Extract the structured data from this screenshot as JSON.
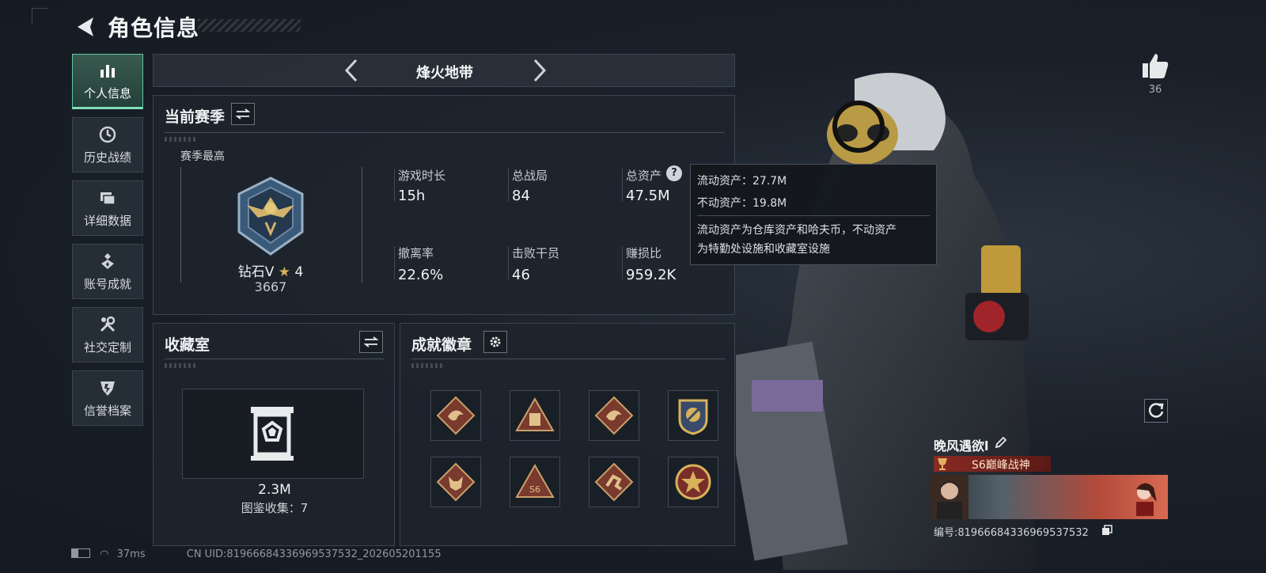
{
  "header": {
    "title": "角色信息"
  },
  "sidebar": {
    "items": [
      {
        "label": "个人信息",
        "icon": "bar-chart-icon",
        "active": true
      },
      {
        "label": "历史战绩",
        "icon": "clock-icon",
        "active": false
      },
      {
        "label": "详细数据",
        "icon": "folders-icon",
        "active": false
      },
      {
        "label": "账号成就",
        "icon": "medal-icon",
        "active": false
      },
      {
        "label": "社交定制",
        "icon": "wrench-icon",
        "active": false
      },
      {
        "label": "信誉档案",
        "icon": "shield-icon",
        "active": false
      }
    ]
  },
  "mode_bar": {
    "title": "烽火地带"
  },
  "season": {
    "title": "当前赛季",
    "best_label": "赛季最高",
    "rank_name": "钻石V",
    "rank_stars": "4",
    "rank_score": "3667",
    "stats": [
      {
        "label": "游戏时长",
        "value": "15h"
      },
      {
        "label": "总战局",
        "value": "84"
      },
      {
        "label": "总资产",
        "value": "47.5M"
      },
      {
        "label": "撤离率",
        "value": "22.6%"
      },
      {
        "label": "击败干员",
        "value": "46"
      },
      {
        "label": "赚损比",
        "value": "959.2K"
      }
    ]
  },
  "tooltip": {
    "line1": "流动资产：27.7M",
    "line2": "不动资产：19.8M",
    "desc1": "流动资产为仓库资产和哈夫币，不动资产",
    "desc2": "为特勤处设施和收藏室设施"
  },
  "collection": {
    "title": "收藏室",
    "value": "2.3M",
    "count_label": "图鉴收集：7"
  },
  "achievements": {
    "title": "成就徽章",
    "badges": [
      "dragon-badge",
      "pyramid-badge",
      "dragon-badge",
      "emblem-badge",
      "wolf-badge",
      "triangle-badge",
      "runner-badge",
      "star-badge"
    ]
  },
  "player": {
    "likes": "36",
    "name": "晚风遇欲l",
    "title": "S6巅峰战神",
    "id_text": "编号:81966684336969537532"
  },
  "status": {
    "ping": "37ms",
    "uid": "CN UID:81966684336969537532_202605201155"
  },
  "colors": {
    "accent": "#7ee0b5",
    "panel": "#1e242c",
    "title_red": "#8a2a22"
  }
}
